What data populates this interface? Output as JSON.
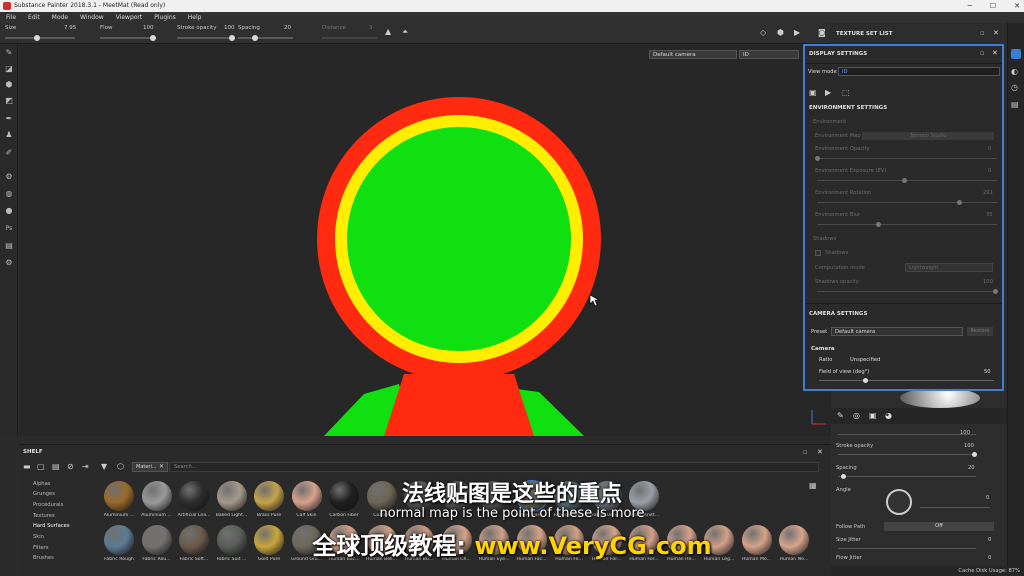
{
  "window": {
    "title": "Substance Painter 2018.3.1 - MeetMat (Read only)"
  },
  "menu": [
    "File",
    "Edit",
    "Mode",
    "Window",
    "Viewport",
    "Plugins",
    "Help"
  ],
  "toolbar": {
    "size_label": "Size",
    "size_value": "7.95",
    "flow_label": "Flow",
    "flow_value": "100",
    "stroke_opacity_label": "Stroke opacity",
    "stroke_opacity_value": "100",
    "spacing_label": "Spacing",
    "spacing_value": "20",
    "distance_label": "Distance",
    "distance_value": "3"
  },
  "viewport": {
    "camera_select": "Default camera",
    "id_select": "ID"
  },
  "texture_set_list": {
    "title": "TEXTURE SET LIST"
  },
  "display_settings": {
    "title": "DISPLAY SETTINGS",
    "view_mode_label": "View mode",
    "view_mode_value": "ID",
    "environment_header": "ENVIRONMENT SETTINGS",
    "environment_group": "Environment",
    "env_map_label": "Environment Map",
    "env_map_value": "Tomoco Studio",
    "env_opacity_label": "Environment Opacity",
    "env_opacity_value": "0",
    "env_exposure_label": "Environment Exposure (EV)",
    "env_exposure_value": "0",
    "env_rotation_label": "Environment Rotation",
    "env_rotation_value": "291",
    "env_blur_label": "Environment Blur",
    "env_blur_value": "35",
    "shadows_group": "Shadows",
    "shadows_check_label": "Shadows",
    "computation_label": "Computation mode",
    "computation_value": "Lightweight",
    "shadows_opacity_label": "Shadows opacity",
    "shadows_opacity_value": "100",
    "camera_header": "CAMERA SETTINGS",
    "preset_label": "Preset",
    "preset_value": "Default camera",
    "restore_label": "Restore",
    "camera_group": "Camera",
    "ratio_label": "Ratio",
    "ratio_value": "Unspecified",
    "fov_label": "Field of view (deg°)",
    "fov_value": "50"
  },
  "properties": {
    "value1": "100",
    "stroke_opacity_label": "Stroke opacity",
    "stroke_opacity_value": "100",
    "spacing_label": "Spacing",
    "spacing_value": "20",
    "angle_label": "Angle",
    "angle_value": "0",
    "follow_path_label": "Follow Path",
    "follow_path_value": "Off",
    "size_jitter_label": "Size Jitter",
    "size_jitter_value": "0",
    "flow_jitter_label": "Flow Jitter",
    "flow_jitter_value": "0"
  },
  "shelf": {
    "title": "SHELF",
    "tab_label": "Materi...",
    "search_placeholder": "Search...",
    "categories": [
      "Alphas",
      "Grunges",
      "Procedurals",
      "Textures",
      "Hard Surfaces",
      "Skin",
      "Filters",
      "Brushes"
    ],
    "row1": [
      "Aluminium ...",
      "Aluminium ...",
      "Artificial Lea...",
      "Baked Light...",
      "Brass Pure",
      "Calf Skin",
      "Carbon Fiber",
      "Coated",
      "",
      "",
      "",
      "Fabric Barn...",
      "Fabric Base...",
      "Fabric Deni...",
      "Fabric Knitt..."
    ],
    "row2": [
      "Fabric Rough",
      "Fabric Rou...",
      "Fabric Soft...",
      "Fabric Suit ...",
      "Gold Pure",
      "Ground Gra...",
      "Human Bac...",
      "Human Bell...",
      "Human Bu...",
      "Human Ch...",
      "Human Eye...",
      "Human Fac...",
      "Human Fe...",
      "Human For...",
      "Human For...",
      "Human He...",
      "Human Leg...",
      "Human Mo...",
      "Human Ne..."
    ],
    "row1_colors": [
      "#9a6a2a",
      "#9a9a9a",
      "#2c2c2c",
      "#a6998a",
      "#c4a24a",
      "#d9a08c",
      "#1f1f1f",
      "#6b6654",
      "#555",
      "#555",
      "#555",
      "#6a6a5e",
      "#5b6e78",
      "#6c7680",
      "#9aa0a8"
    ],
    "row2_colors": [
      "#5d7a94",
      "#74716e",
      "#6a5a4c",
      "#5a5d5a",
      "#c8a53c",
      "#6e685c",
      "#d9a286",
      "#d4a084",
      "#cf9a80",
      "#d6a38a",
      "#d0a088",
      "#d5a286",
      "#d2a084",
      "#d8a48a",
      "#d39e86",
      "#d6a08a",
      "#d1a086",
      "#d4a288",
      "#d8a48c"
    ]
  },
  "subtitles": {
    "chinese": "法线贴图是这些的重点",
    "english": "normal map is the point of these is more",
    "watermark_cn": "全球顶级教程:",
    "watermark_url": "www.VeryCG.com"
  },
  "status": {
    "cache": "Cache Disk Usage:",
    "cache_value": "87%"
  },
  "colors": {
    "accent": "#3d7fd4",
    "red": "#ff2a10",
    "yellow": "#ffee00",
    "green": "#10e010"
  }
}
